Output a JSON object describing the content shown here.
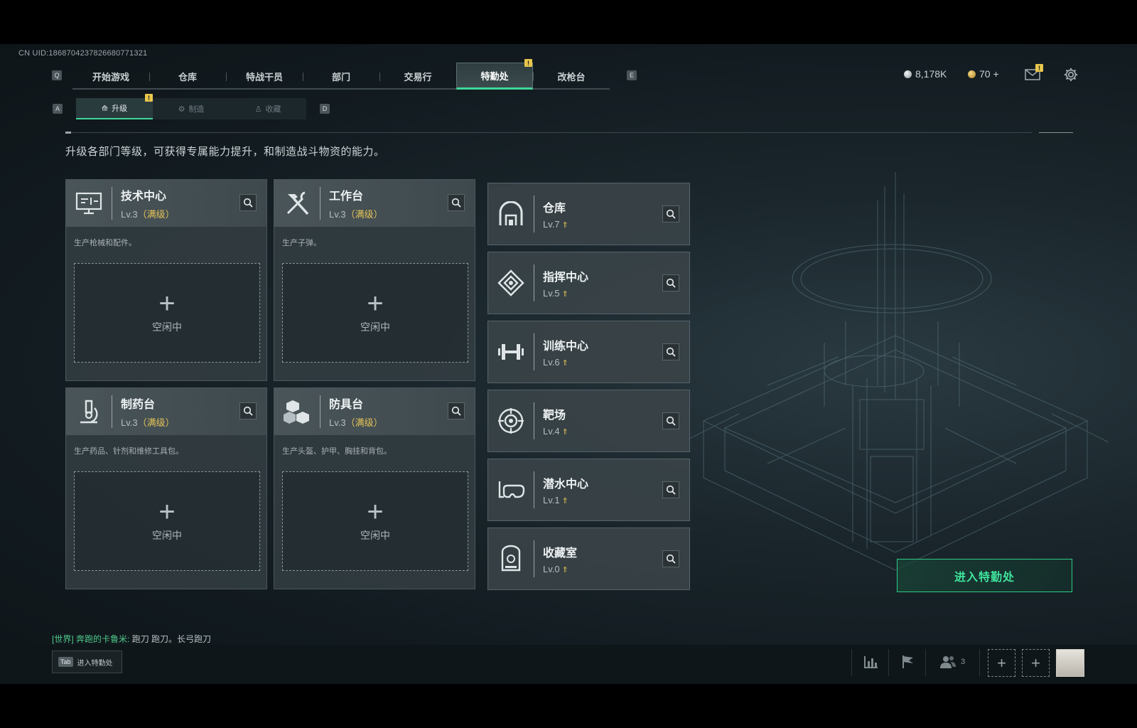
{
  "uid": "CN UID:1868704237826680771321",
  "keys": {
    "q": "Q",
    "e": "E",
    "a": "A",
    "d": "D",
    "tab": "Tab"
  },
  "main_tabs": [
    {
      "label": "开始游戏"
    },
    {
      "label": "仓库"
    },
    {
      "label": "特战干员"
    },
    {
      "label": "部门"
    },
    {
      "label": "交易行"
    },
    {
      "label": "特勤处",
      "active": true,
      "badge": "!"
    },
    {
      "label": "改枪台"
    }
  ],
  "currency": {
    "silver": "8,178K",
    "gold": "70 +"
  },
  "mail_badge": "!",
  "sub_tabs": [
    {
      "label": "升级",
      "active": true,
      "badge": "!"
    },
    {
      "label": "制造"
    },
    {
      "label": "收藏"
    }
  ],
  "description": "升级各部门等级，可获得专属能力提升，和制造战斗物资的能力。",
  "production_cards": [
    {
      "name": "技术中心",
      "level": "Lv.3",
      "max": "（满级）",
      "desc": "生产枪械和配件。",
      "slot": "空闲中",
      "icon": "monitor-icon"
    },
    {
      "name": "工作台",
      "level": "Lv.3",
      "max": "（满级）",
      "desc": "生产子弹。",
      "slot": "空闲中",
      "icon": "hammer-wrench-icon"
    },
    {
      "name": "制药台",
      "level": "Lv.3",
      "max": "（满级）",
      "desc": "生产药品、针剂和维修工具包。",
      "slot": "空闲中",
      "icon": "microscope-icon"
    },
    {
      "name": "防具台",
      "level": "Lv.3",
      "max": "（满级）",
      "desc": "生产头盔、护甲、胸挂和背包。",
      "slot": "空闲中",
      "icon": "cubes-icon"
    }
  ],
  "facility_cards": [
    {
      "name": "仓库",
      "level": "Lv.7",
      "icon": "warehouse-icon"
    },
    {
      "name": "指挥中心",
      "level": "Lv.5",
      "icon": "command-chip-icon"
    },
    {
      "name": "训练中心",
      "level": "Lv.6",
      "icon": "dumbbell-icon"
    },
    {
      "name": "靶场",
      "level": "Lv.4",
      "icon": "target-icon"
    },
    {
      "name": "潜水中心",
      "level": "Lv.1",
      "icon": "diving-mask-icon"
    },
    {
      "name": "收藏室",
      "level": "Lv.0",
      "icon": "display-case-icon"
    }
  ],
  "upgrade_arrow": "⇑",
  "enter_button": "进入特勤处",
  "chat": {
    "channel": "[世界]",
    "sender": "奔跑的卡鲁米:",
    "message": "跑刀 跑刀。长弓跑刀"
  },
  "bottom": {
    "tab_hint": "进入特勤处",
    "team_count": "3",
    "plus": "+"
  },
  "colors": {
    "accent_green": "#3fd89a",
    "gold": "#e3c258"
  }
}
